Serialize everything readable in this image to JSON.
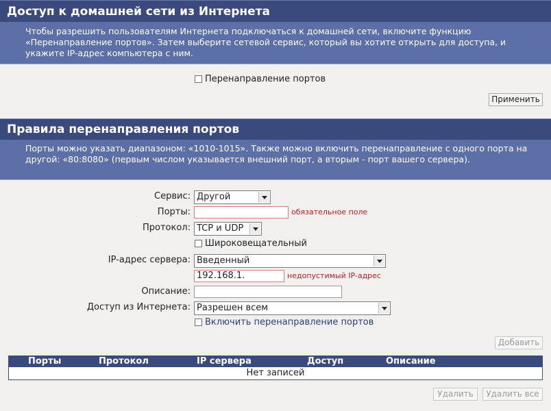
{
  "section1": {
    "title": "Доступ к домашней сети из Интернета",
    "description": "Чтобы разрешить пользователям Интернета подключаться к домашней сети, включите функцию «Перенаправление портов». Затем выберите сетевой сервис, который вы хотите открыть для доступа, и укажите IP-адрес компьютера с ним.",
    "port_forwarding_checkbox_label": "Перенаправление портов",
    "port_forwarding_checked": false,
    "apply_button": "Применить"
  },
  "section2": {
    "title": "Правила перенаправления портов",
    "description": "Порты можно указать диапазоном: «1010-1015». Также можно включить перенаправление с одного порта на другой: «80:8080» (первым числом указывается внешний порт, а вторым - порт вашего сервера)."
  },
  "form": {
    "service_label": "Сервис:",
    "service_value": "Другой",
    "ports_label": "Порты:",
    "ports_value": "",
    "ports_error": "обязательное поле",
    "protocol_label": "Протокол:",
    "protocol_value": "TCP и UDP",
    "broadcast_label": "Широковещательный",
    "broadcast_checked": false,
    "server_ip_label": "IP-адрес сервера:",
    "server_ip_mode": "Введенный",
    "server_ip_value": "192.168.1.",
    "server_ip_error": "недопустимый IP-адрес",
    "description_label": "Описание:",
    "description_value": "",
    "internet_access_label": "Доступ из Интернета:",
    "internet_access_value": "Разрешен всем",
    "enable_forwarding_label": "Включить перенаправление портов",
    "enable_forwarding_checked": false,
    "add_button": "Добавить"
  },
  "table": {
    "columns": [
      "Порты",
      "Протокол",
      "IP сервера",
      "Доступ",
      "Описание"
    ],
    "empty_text": "Нет записей"
  },
  "actions": {
    "delete_button": "Удалить",
    "delete_all_button": "Удалить все"
  },
  "colors": {
    "header_bg": "#3a4a7d",
    "description_bg": "#5c6fa6",
    "error_text": "#b22222",
    "page_bg": "#f1f0ee"
  },
  "icons": {
    "dropdown": "chevron-down-icon",
    "checkbox": "checkbox-icon"
  }
}
